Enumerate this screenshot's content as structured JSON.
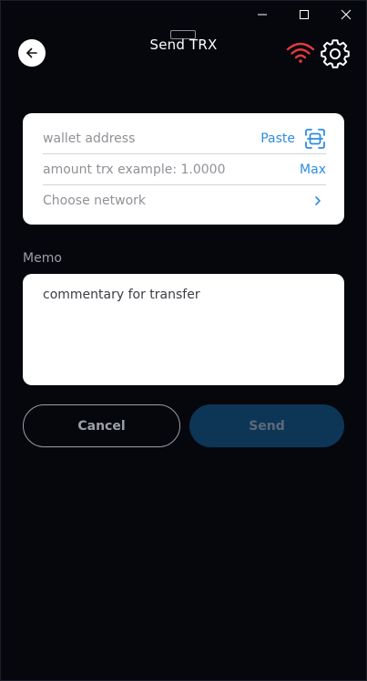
{
  "window": {
    "minimize_icon": "minimize-icon",
    "maximize_icon": "maximize-icon",
    "close_icon": "close-icon"
  },
  "header": {
    "title": "Send TRX",
    "back_icon": "arrow-left-icon",
    "network_status_icon": "wifi-icon",
    "settings_icon": "gear-icon",
    "network_status_color": "#e53a3a"
  },
  "form": {
    "wallet_address": {
      "placeholder": "wallet address",
      "paste_label": "Paste",
      "scan_icon": "qr-scan-icon"
    },
    "amount": {
      "placeholder": "amount trx example: 1.0000",
      "max_label": "Max"
    },
    "network": {
      "placeholder": "Choose network",
      "chevron_icon": "chevron-right-icon"
    }
  },
  "memo": {
    "label": "Memo",
    "placeholder": "commentary for transfer"
  },
  "actions": {
    "cancel_label": "Cancel",
    "send_label": "Send"
  },
  "colors": {
    "background": "#05070d",
    "accent_blue": "#2f8ce0",
    "send_disabled_bg": "#0d3656"
  }
}
